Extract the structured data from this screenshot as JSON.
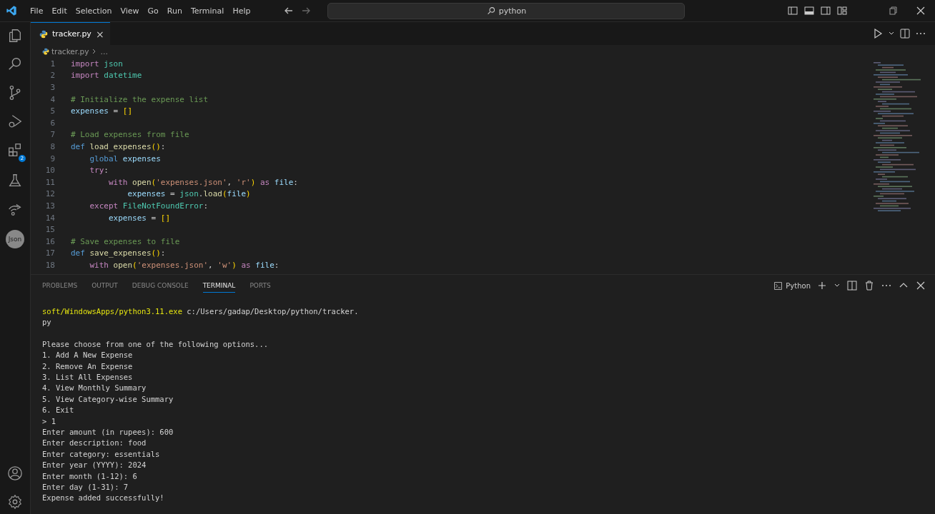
{
  "menu": [
    "File",
    "Edit",
    "Selection",
    "View",
    "Go",
    "Run",
    "Terminal",
    "Help"
  ],
  "command_center": {
    "value": "python"
  },
  "activity_bar": {
    "extensions_badge": "2",
    "json_label": "Json"
  },
  "editor_tabs": [
    {
      "label": "tracker.py",
      "selected": true,
      "close": "×"
    }
  ],
  "breadcrumb": [
    "tracker.py",
    "…"
  ],
  "code_lines": [
    {
      "n": "1",
      "tokens": [
        {
          "t": "import",
          "kind": "kw"
        },
        {
          "t": " json",
          "kind": "mod"
        }
      ]
    },
    {
      "n": "2",
      "tokens": [
        {
          "t": "import",
          "kind": "kw"
        },
        {
          "t": " datetime",
          "kind": "mod"
        }
      ]
    },
    {
      "n": "3"
    },
    {
      "n": "4",
      "tokens": [
        {
          "t": "# Initialize the expense list",
          "kind": "com"
        }
      ]
    },
    {
      "n": "5",
      "tokens": [
        {
          "t": "expenses",
          "kind": "var"
        },
        {
          "t": " = ",
          "kind": "plain"
        },
        {
          "t": "[]",
          "kind": "br"
        }
      ]
    },
    {
      "n": "6"
    },
    {
      "n": "7",
      "tokens": [
        {
          "t": "# Load expenses from file",
          "kind": "com"
        }
      ]
    },
    {
      "n": "8",
      "tokens": [
        {
          "t": "def",
          "kind": "def"
        },
        {
          "t": " load_expenses",
          "kind": "fn"
        },
        {
          "t": "()",
          "kind": "br"
        },
        {
          "t": ":",
          "kind": "plain"
        }
      ]
    },
    {
      "n": "9",
      "tokens": [
        {
          "t": "    global",
          "kind": "def"
        },
        {
          "t": " expenses",
          "kind": "var"
        }
      ]
    },
    {
      "n": "10",
      "tokens": [
        {
          "t": "    try",
          "kind": "kw"
        },
        {
          "t": ":",
          "kind": "plain"
        }
      ]
    },
    {
      "n": "11",
      "tokens": [
        {
          "t": "        with",
          "kind": "kw"
        },
        {
          "t": " open",
          "kind": "fn"
        },
        {
          "t": "(",
          "kind": "br"
        },
        {
          "t": "'expenses.json'",
          "kind": "str"
        },
        {
          "t": ", ",
          "kind": "plain"
        },
        {
          "t": "'r'",
          "kind": "str"
        },
        {
          "t": ")",
          "kind": "br"
        },
        {
          "t": " as",
          "kind": "kw"
        },
        {
          "t": " file",
          "kind": "var"
        },
        {
          "t": ":",
          "kind": "plain"
        }
      ]
    },
    {
      "n": "12",
      "tokens": [
        {
          "t": "            expenses",
          "kind": "var"
        },
        {
          "t": " = ",
          "kind": "plain"
        },
        {
          "t": "json",
          "kind": "mod"
        },
        {
          "t": ".",
          "kind": "plain"
        },
        {
          "t": "load",
          "kind": "fn"
        },
        {
          "t": "(",
          "kind": "br"
        },
        {
          "t": "file",
          "kind": "var"
        },
        {
          "t": ")",
          "kind": "br"
        }
      ]
    },
    {
      "n": "13",
      "tokens": [
        {
          "t": "    except",
          "kind": "kw"
        },
        {
          "t": " FileNotFoundError",
          "kind": "mod"
        },
        {
          "t": ":",
          "kind": "plain"
        }
      ]
    },
    {
      "n": "14",
      "tokens": [
        {
          "t": "        expenses",
          "kind": "var"
        },
        {
          "t": " = ",
          "kind": "plain"
        },
        {
          "t": "[]",
          "kind": "br"
        }
      ]
    },
    {
      "n": "15"
    },
    {
      "n": "16",
      "tokens": [
        {
          "t": "# Save expenses to file",
          "kind": "com"
        }
      ]
    },
    {
      "n": "17",
      "tokens": [
        {
          "t": "def",
          "kind": "def"
        },
        {
          "t": " save_expenses",
          "kind": "fn"
        },
        {
          "t": "()",
          "kind": "br"
        },
        {
          "t": ":",
          "kind": "plain"
        }
      ]
    },
    {
      "n": "18",
      "tokens": [
        {
          "t": "    with",
          "kind": "kw"
        },
        {
          "t": " open",
          "kind": "fn"
        },
        {
          "t": "(",
          "kind": "br"
        },
        {
          "t": "'expenses.json'",
          "kind": "str"
        },
        {
          "t": ", ",
          "kind": "plain"
        },
        {
          "t": "'w'",
          "kind": "str"
        },
        {
          "t": ")",
          "kind": "br"
        },
        {
          "t": " as",
          "kind": "kw"
        },
        {
          "t": " file",
          "kind": "var"
        },
        {
          "t": ":",
          "kind": "plain"
        }
      ]
    }
  ],
  "panel_tabs": [
    {
      "label": "PROBLEMS",
      "selected": false
    },
    {
      "label": "OUTPUT",
      "selected": false
    },
    {
      "label": "DEBUG CONSOLE",
      "selected": false
    },
    {
      "label": "TERMINAL",
      "selected": true
    },
    {
      "label": "PORTS",
      "selected": false
    }
  ],
  "terminal_profile": "Python",
  "terminal_lines": [
    {
      "kind": "text",
      "tokens": [
        {
          "t": "soft/WindowsApps/python3.11.exe",
          "kind": "cmd"
        },
        {
          "t": " c:/Users/gadap/Desktop/python/tracker.",
          "kind": "plain"
        }
      ]
    },
    {
      "kind": "text",
      "tokens": [
        {
          "t": "py",
          "kind": "plain"
        }
      ]
    },
    {
      "kind": "blank"
    },
    {
      "kind": "text",
      "tokens": [
        {
          "t": "Please choose from one of the following options...",
          "kind": "plain"
        }
      ]
    },
    {
      "kind": "text",
      "tokens": [
        {
          "t": "1. Add A New Expense",
          "kind": "plain"
        }
      ]
    },
    {
      "kind": "text",
      "tokens": [
        {
          "t": "2. Remove An Expense",
          "kind": "plain"
        }
      ]
    },
    {
      "kind": "text",
      "tokens": [
        {
          "t": "3. List All Expenses",
          "kind": "plain"
        }
      ]
    },
    {
      "kind": "text",
      "tokens": [
        {
          "t": "4. View Monthly Summary",
          "kind": "plain"
        }
      ]
    },
    {
      "kind": "text",
      "tokens": [
        {
          "t": "5. View Category-wise Summary",
          "kind": "plain"
        }
      ]
    },
    {
      "kind": "text",
      "tokens": [
        {
          "t": "6. Exit",
          "kind": "plain"
        }
      ]
    },
    {
      "kind": "text",
      "tokens": [
        {
          "t": "> 1",
          "kind": "plain"
        }
      ]
    },
    {
      "kind": "text",
      "tokens": [
        {
          "t": "Enter amount (in rupees): 600",
          "kind": "plain"
        }
      ]
    },
    {
      "kind": "text",
      "tokens": [
        {
          "t": "Enter description: food",
          "kind": "plain"
        }
      ]
    },
    {
      "kind": "text",
      "tokens": [
        {
          "t": "Enter category: essentials",
          "kind": "plain"
        }
      ]
    },
    {
      "kind": "text",
      "tokens": [
        {
          "t": "Enter year (YYYY): 2024",
          "kind": "plain"
        }
      ]
    },
    {
      "kind": "text",
      "tokens": [
        {
          "t": "Enter month (1-12): 6",
          "kind": "plain"
        }
      ]
    },
    {
      "kind": "text",
      "tokens": [
        {
          "t": "Enter day (1-31): 7",
          "kind": "plain"
        }
      ]
    },
    {
      "kind": "text",
      "tokens": [
        {
          "t": "Expense added successfully!",
          "kind": "plain"
        }
      ]
    }
  ]
}
